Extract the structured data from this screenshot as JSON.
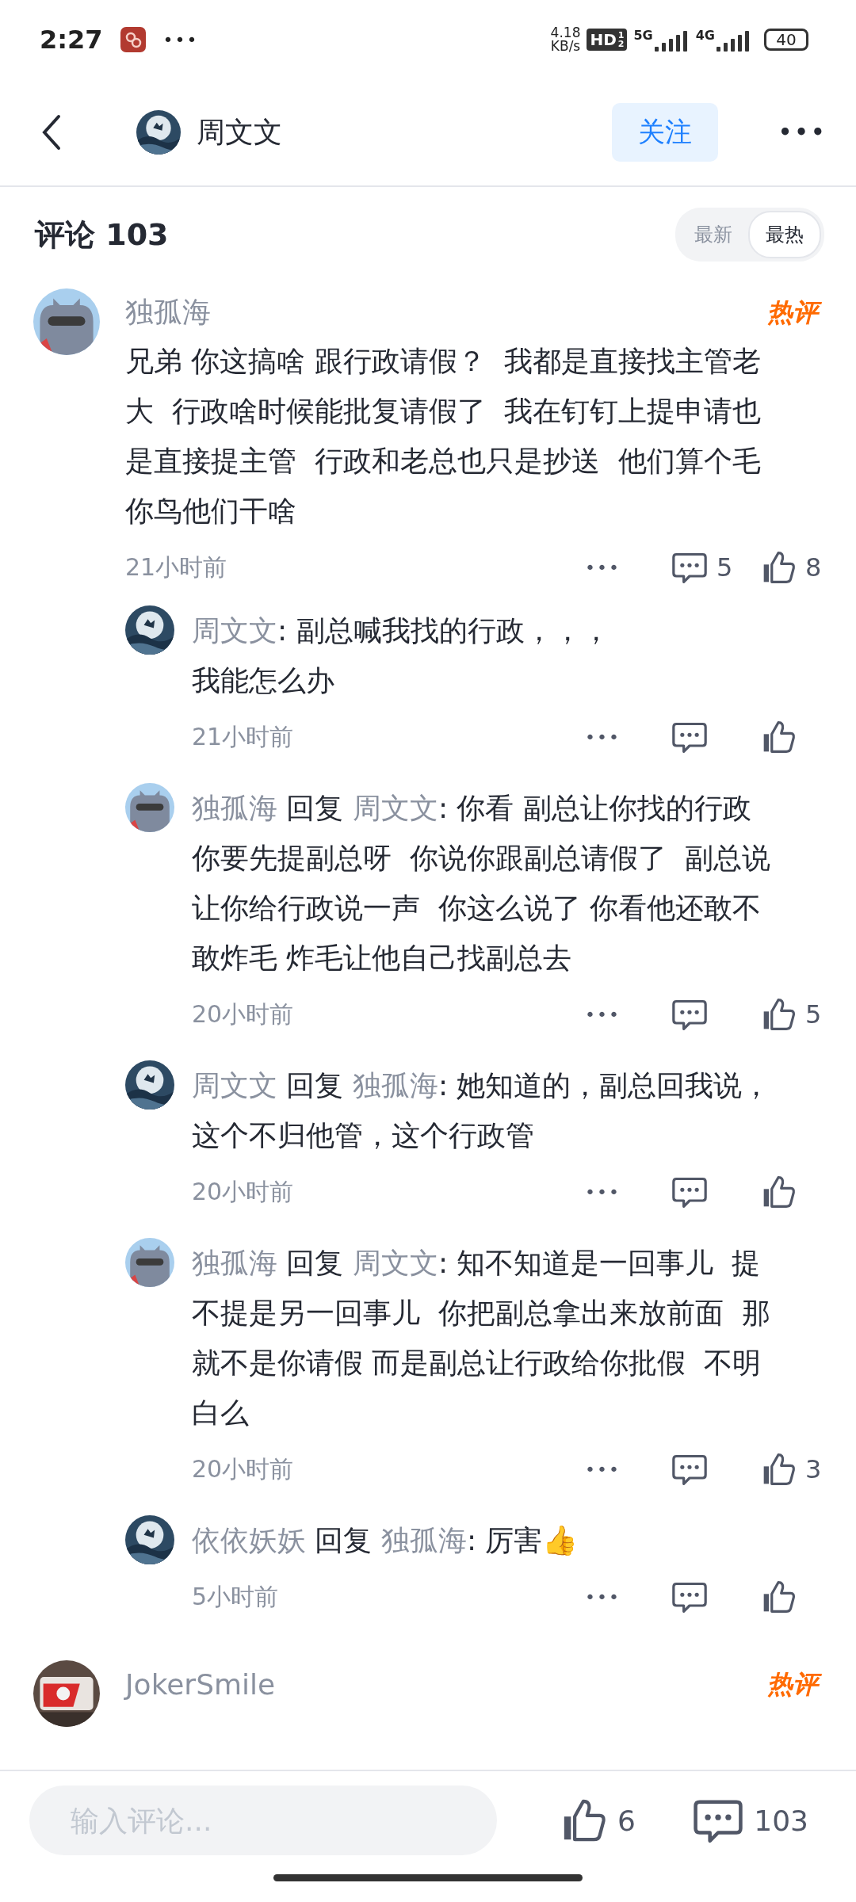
{
  "status_bar": {
    "time": "2:27",
    "more": "•••",
    "speed": [
      "4.18",
      "KB/s"
    ],
    "hd": "HD",
    "hd_sub": [
      "1",
      "2"
    ],
    "networks": [
      "5G",
      "4G"
    ],
    "battery": "40"
  },
  "header": {
    "title": "周文文",
    "follow_button": "关注",
    "more": "•••"
  },
  "comments_header": {
    "title": "评论 103",
    "sort_tabs": [
      {
        "label": "最新",
        "selected": false
      },
      {
        "label": "最热",
        "selected": true
      }
    ]
  },
  "comments": [
    {
      "author": "独孤海",
      "badge": "热评",
      "text": "兄弟 你这搞啥 跟行政请假？  我都是直接找主管老大  行政啥时候能批复请假了  我在钉钉上提申请也是直接提主管  行政和老总也只是抄送  他们算个毛你鸟他们干啥",
      "time": "21小时前",
      "more": "•••",
      "reply_count": "5",
      "likes": "8",
      "replies": [
        {
          "author": "周文文",
          "text": ": 副总喊我找的行政，，，",
          "text_continued": "我能怎么办",
          "time": "21小时前",
          "more": "•••"
        },
        {
          "author": "独孤海",
          "reply_word": "回复",
          "reply_to": "周文文",
          "text": ": 你看 副总让你找的行政你要先提副总呀  你说你跟副总请假了  副总说让你给行政说一声  你这么说了 你看他还敢不敢炸毛 炸毛让他自己找副总去",
          "time": "20小时前",
          "more": "•••",
          "likes": "5"
        },
        {
          "author": "周文文",
          "reply_word": "回复",
          "reply_to": "独孤海",
          "text": ": 她知道的，副总回我说，这个不归他管，这个行政管",
          "time": "20小时前",
          "more": "•••"
        },
        {
          "author": "独孤海",
          "reply_word": "回复",
          "reply_to": "周文文",
          "text": ": 知不知道是一回事儿  提不提是另一回事儿  你把副总拿出来放前面  那就不是你请假 而是副总让行政给你批假  不明白么",
          "time": "20小时前",
          "more": "•••",
          "likes": "3"
        },
        {
          "author": "依依妖妖",
          "reply_word": "回复",
          "reply_to": "独孤海",
          "text": ": 厉害👍",
          "time": "5小时前",
          "more": "•••"
        }
      ]
    },
    {
      "author": "JokerSmile",
      "badge": "热评"
    }
  ],
  "bottom_bar": {
    "placeholder": "输入评论...",
    "likes": "6",
    "comments": "103"
  }
}
